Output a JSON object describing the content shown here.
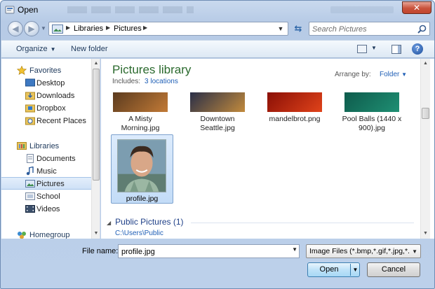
{
  "window": {
    "title": "Open",
    "close_label": "✕"
  },
  "address": {
    "crumbs": [
      "Libraries",
      "Pictures"
    ],
    "separator": "▶",
    "dropdown": "▼"
  },
  "search": {
    "placeholder": "Search Pictures"
  },
  "toolbar": {
    "organize_label": "Organize",
    "new_folder_label": "New folder",
    "help_label": "?"
  },
  "sidebar": {
    "favorites": {
      "label": "Favorites",
      "items": [
        "Desktop",
        "Downloads",
        "Dropbox",
        "Recent Places"
      ]
    },
    "libraries": {
      "label": "Libraries",
      "items": [
        "Documents",
        "Music",
        "Pictures",
        "School",
        "Videos"
      ]
    },
    "homegroup": {
      "label": "Homegroup"
    },
    "selected": "Pictures"
  },
  "library": {
    "title": "Pictures library",
    "includes_label": "Includes:",
    "includes_link": "3 locations",
    "arrange_label": "Arrange by:",
    "arrange_value": "Folder"
  },
  "files": [
    {
      "name": "A Misty Morning.jpg",
      "line1": "A Misty",
      "line2": "Morning.jpg",
      "colors": [
        "#5b3b1f",
        "#c27a36"
      ]
    },
    {
      "name": "Downtown Seattle.jpg",
      "line1": "Downtown",
      "line2": "Seattle.jpg",
      "colors": [
        "#2a2f48",
        "#c28a3c"
      ]
    },
    {
      "name": "mandelbrot.png",
      "line1": "mandelbrot.png",
      "line2": "",
      "colors": [
        "#8a0f06",
        "#e0431a"
      ]
    },
    {
      "name": "Pool Balls (1440 x 900).jpg",
      "line1": "Pool Balls (1440 x",
      "line2": "900).jpg",
      "colors": [
        "#0e5b4c",
        "#1f8f73"
      ]
    }
  ],
  "selected_file": {
    "name": "profile.jpg"
  },
  "group": {
    "title": "Public Pictures (1)",
    "path": "C:\\Users\\Public"
  },
  "bottom": {
    "filename_label": "File name:",
    "filename_value": "profile.jpg",
    "filetype_value": "Image Files (*.bmp,*.gif,*.jpg,*.",
    "open_label": "Open",
    "cancel_label": "Cancel"
  }
}
